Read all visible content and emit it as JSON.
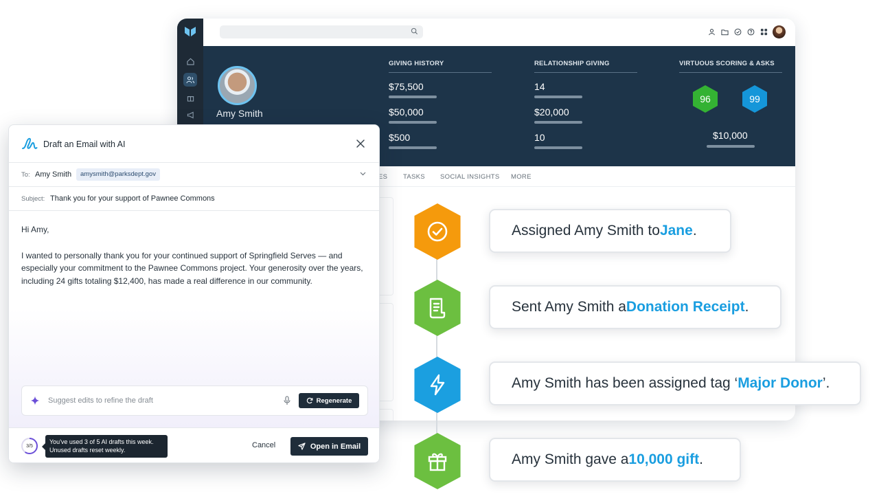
{
  "app": {
    "search": {
      "placeholder": ""
    },
    "profile": {
      "name": "Amy Smith"
    },
    "giving_history": {
      "header": "GIVING HISTORY",
      "values": [
        "$75,500",
        "$50,000",
        "$500"
      ]
    },
    "relationship_giving": {
      "header": "RELATIONSHIP GIVING",
      "values": [
        "14",
        "$20,000",
        "10"
      ]
    },
    "virtuous_scoring": {
      "header": "VIRTUOUS SCORING & ASKS",
      "score_green": "96",
      "score_blue": "99",
      "ask_amount": "$10,000"
    },
    "tabs": [
      "ES",
      "TASKS",
      "SOCIAL INSIGHTS",
      "MORE"
    ],
    "colors": {
      "hero": "#1d3449",
      "rail": "#1e2a36",
      "accent_blue": "#1a9ee0",
      "score_green": "#34b233",
      "score_blue": "#1596d9"
    }
  },
  "timeline": [
    {
      "icon": "check-circle-icon",
      "color": "#f59a0c",
      "prefix": "Assigned Amy Smith to ",
      "highlight": "Jane",
      "suffix": "."
    },
    {
      "icon": "receipt-icon",
      "color": "#6cbf40",
      "prefix": "Sent Amy Smith a ",
      "highlight": "Donation Receipt",
      "suffix": "."
    },
    {
      "icon": "lightning-icon",
      "color": "#1b9fe0",
      "prefix": "Amy Smith has been assigned tag ‘",
      "highlight": "Major Donor",
      "suffix": "’."
    },
    {
      "icon": "gift-icon",
      "color": "#6cbf40",
      "prefix": "Amy Smith gave a ",
      "highlight": "10,000 gift",
      "suffix": "."
    }
  ],
  "email": {
    "title": "Draft an Email with AI",
    "to_label": "To:",
    "to_name": "Amy Smith",
    "to_email": "amysmith@parksdept.gov",
    "subject_label": "Subject:",
    "subject": "Thank you for your support of Pawnee Commons",
    "greeting": "Hi Amy,",
    "body": "I wanted to personally thank you for your continued support of Springfield Serves — and especially your commitment to the Pawnee Commons project. Your generosity over the years, including 24 gifts totaling $12,400, has made a real difference in our community.",
    "suggest_placeholder": "Suggest edits to refine the draft",
    "regenerate_label": "Regenerate",
    "usage_count": "3/5",
    "usage_fraction": 0.6,
    "tooltip_line1": "You've used 3 of 5 AI drafts this week.",
    "tooltip_line2": "Unused drafts reset weekly.",
    "cancel_label": "Cancel",
    "open_label": "Open in Email"
  }
}
